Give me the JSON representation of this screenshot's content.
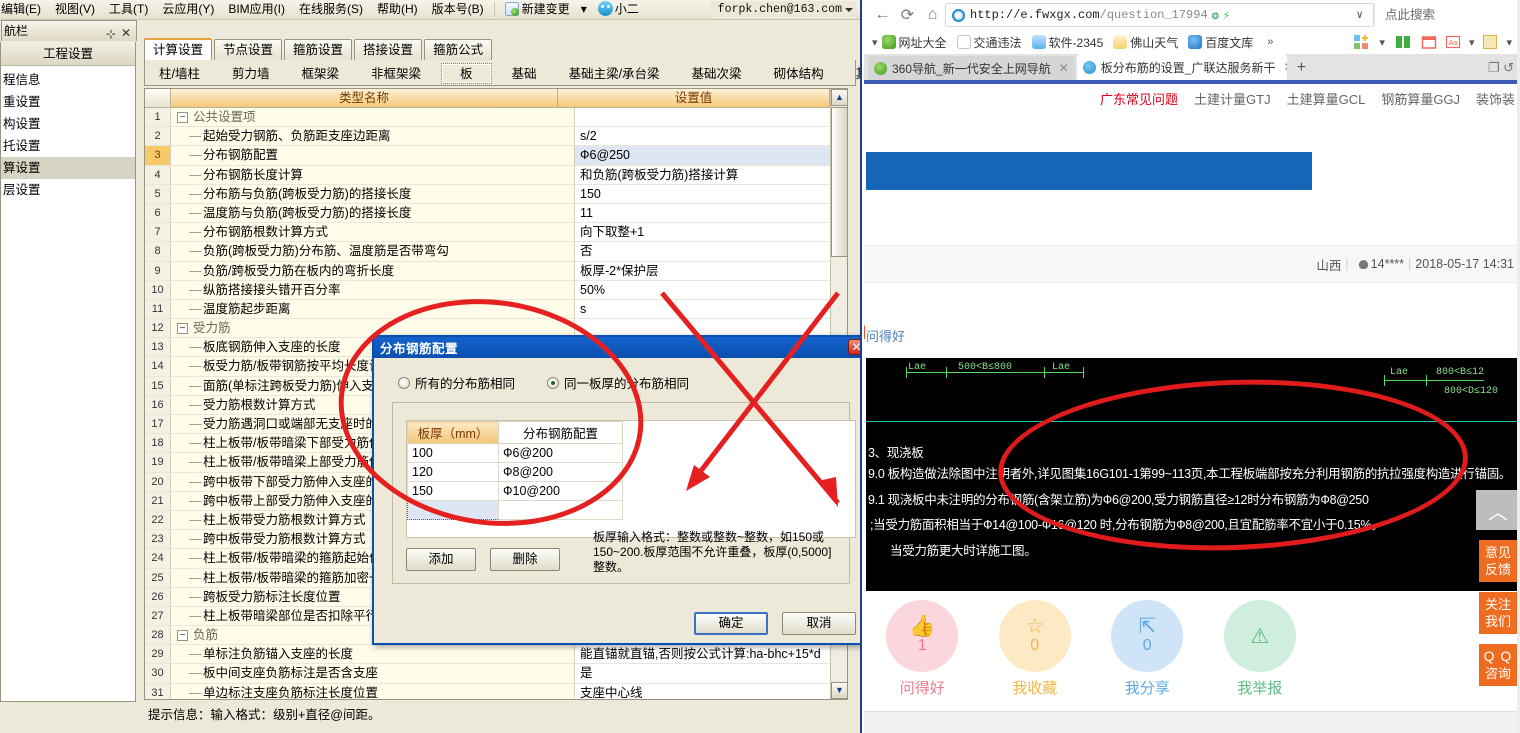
{
  "app": {
    "menubar": {
      "items": [
        "编辑(E)",
        "视图(V)",
        "工具(T)",
        "云应用(Y)",
        "BIM应用(I)",
        "在线服务(S)",
        "帮助(H)",
        "版本号(B)"
      ],
      "new_change_label": "新建变更",
      "qq_label": "小二",
      "account": "forpk.chen@163.com"
    },
    "dock": {
      "title": "航栏",
      "pin_icon": "pin-icon",
      "close_icon": "close-icon",
      "header": "工程设置",
      "items": [
        "程信息",
        "重设置",
        "构设置",
        "托设置",
        "算设置",
        "层设置"
      ],
      "selected_index": 4
    },
    "tabs_primary": [
      "计算设置",
      "节点设置",
      "箍筋设置",
      "搭接设置",
      "箍筋公式"
    ],
    "tabs_primary_active": 0,
    "tabs_secondary": [
      "柱/墙柱",
      "剪力墙",
      "框架梁",
      "非框架梁",
      "板",
      "基础",
      "基础主梁/承台梁",
      "基础次梁",
      "砌体结构",
      "其它"
    ],
    "tabs_secondary_active": 4,
    "grid": {
      "headers": {
        "num": "",
        "name": "类型名称",
        "value": "设置值"
      },
      "rows": [
        {
          "n": "1",
          "type": "group",
          "name": "公共设置项",
          "value": ""
        },
        {
          "n": "2",
          "type": "item",
          "name": "起始受力钢筋、负筋距支座边距离",
          "value": "s/2"
        },
        {
          "n": "3",
          "type": "item",
          "name": "分布钢筋配置",
          "value": "Ф6@250",
          "selected": true
        },
        {
          "n": "4",
          "type": "item",
          "name": "分布钢筋长度计算",
          "value": "和负筋(跨板受力筋)搭接计算"
        },
        {
          "n": "5",
          "type": "item",
          "name": "分布筋与负筋(跨板受力筋)的搭接长度",
          "value": "150"
        },
        {
          "n": "6",
          "type": "item",
          "name": "温度筋与负筋(跨板受力筋)的搭接长度",
          "value": "11"
        },
        {
          "n": "7",
          "type": "item",
          "name": "分布钢筋根数计算方式",
          "value": "向下取整+1"
        },
        {
          "n": "8",
          "type": "item",
          "name": "负筋(跨板受力筋)分布筋、温度筋是否带弯勾",
          "value": "否"
        },
        {
          "n": "9",
          "type": "item",
          "name": "负筋/跨板受力筋在板内的弯折长度",
          "value": "板厚-2*保护层"
        },
        {
          "n": "10",
          "type": "item",
          "name": "纵筋搭接接头错开百分率",
          "value": "50%"
        },
        {
          "n": "11",
          "type": "item",
          "name": "温度筋起步距离",
          "value": "s"
        },
        {
          "n": "12",
          "type": "group",
          "name": "受力筋",
          "value": ""
        },
        {
          "n": "13",
          "type": "item",
          "name": "板底钢筋伸入支座的长度",
          "value": ""
        },
        {
          "n": "14",
          "type": "item",
          "name": "板受力筋/板带钢筋按平均长度计算",
          "value": ""
        },
        {
          "n": "15",
          "type": "item",
          "name": "面筋(单标注跨板受力筋)伸入支座",
          "value": ""
        },
        {
          "n": "16",
          "type": "item",
          "name": "受力筋根数计算方式",
          "value": ""
        },
        {
          "n": "17",
          "type": "item",
          "name": "受力筋遇洞口或端部无支座时的",
          "value": ""
        },
        {
          "n": "18",
          "type": "item",
          "name": "柱上板带/板带暗梁下部受力筋伸",
          "value": ""
        },
        {
          "n": "19",
          "type": "item",
          "name": "柱上板带/板带暗梁上部受力筋伸",
          "value": ""
        },
        {
          "n": "20",
          "type": "item",
          "name": "跨中板带下部受力筋伸入支座的",
          "value": ""
        },
        {
          "n": "21",
          "type": "item",
          "name": "跨中板带上部受力筋伸入支座的",
          "value": ""
        },
        {
          "n": "22",
          "type": "item",
          "name": "柱上板带受力筋根数计算方式",
          "value": ""
        },
        {
          "n": "23",
          "type": "item",
          "name": "跨中板带受力筋根数计算方式",
          "value": ""
        },
        {
          "n": "24",
          "type": "item",
          "name": "柱上板带/板带暗梁的箍筋起始位",
          "value": ""
        },
        {
          "n": "25",
          "type": "item",
          "name": "柱上板带/板带暗梁的箍筋加密长",
          "value": ""
        },
        {
          "n": "26",
          "type": "item",
          "name": "跨板受力筋标注长度位置",
          "value": ""
        },
        {
          "n": "27",
          "type": "item",
          "name": "柱上板带暗梁部位是否扣除平行",
          "value": ""
        },
        {
          "n": "28",
          "type": "group",
          "name": "负筋",
          "value": ""
        },
        {
          "n": "29",
          "type": "item",
          "name": "单标注负筋锚入支座的长度",
          "value": "能直锚就直锚,否则按公式计算:ha-bhc+15*d"
        },
        {
          "n": "30",
          "type": "item",
          "name": "板中间支座负筋标注是否含支座",
          "value": "是"
        },
        {
          "n": "31",
          "type": "item",
          "name": "单边标注支座负筋标注长度位置",
          "value": "支座中心线"
        }
      ]
    },
    "statusbar": "提示信息：输入格式：级别+直径@间距。"
  },
  "dialog": {
    "title": "分布钢筋配置",
    "close_icon": "close-icon",
    "radio_all": "所有的分布筋相同",
    "radio_same_thickness": "同一板厚的分布筋相同",
    "radio_selected": "same_thickness",
    "table": {
      "headers": [
        "板厚（mm）",
        "分布钢筋配置"
      ],
      "rows": [
        {
          "thickness": "100",
          "rebar": "Ф6@200"
        },
        {
          "thickness": "120",
          "rebar": "Ф8@200"
        },
        {
          "thickness": "150",
          "rebar": "Ф10@200"
        },
        {
          "thickness": "",
          "rebar": ""
        }
      ]
    },
    "add_label": "添加",
    "delete_label": "删除",
    "hint": "板厚输入格式：整数或整数~整数，如150或150~200.板厚范围不允许重叠，板厚(0,5000]整数。",
    "ok_label": "确定",
    "cancel_label": "取消"
  },
  "browser": {
    "nav": {
      "back_icon": "back-arrow-icon",
      "reload_icon": "reload-icon",
      "home_icon": "home-icon",
      "url_domain": "http://e.fwxgx.com",
      "url_path": "/question_17994",
      "shield_icon": "shield-icon",
      "lightning_icon": "lightning-icon",
      "dropdown_icon": "chevron-down-icon",
      "search_placeholder": "点此搜索"
    },
    "bookmarks": [
      "网址大全",
      "交通违法",
      "软件-2345",
      "佛山天气",
      "百度文库"
    ],
    "bookmarks_more_icon": "chevron-double-right-icon",
    "toolbar_icons": [
      "apps-icon",
      "book-icon",
      "calendar-icon",
      "translate-icon",
      "notes-icon"
    ],
    "tabs": [
      {
        "title": "360导航_新一代安全上网导航",
        "active": false,
        "favicon": "360-icon"
      },
      {
        "title": "板分布筋的设置_广联达服务新干",
        "active": true,
        "favicon": "glodon-icon"
      }
    ],
    "new_tab_icon": "plus-icon",
    "tab_tools": [
      "restore-icon",
      "undo-icon"
    ],
    "site_nav": {
      "active": "广东常见问题",
      "items": [
        "土建计量GTJ",
        "土建算量GCL",
        "钢筋算量GGJ",
        "装饰装"
      ]
    },
    "meta": {
      "region": "山西",
      "user_icon": "user-icon",
      "user": "14****",
      "datetime": "2018-05-17 14:31"
    },
    "ask_good_label": "问得好",
    "cad": {
      "dims": [
        "Lae",
        "500<B≤800",
        "Lae",
        "Lae",
        "800<B≤12",
        "800<D≤120"
      ],
      "lines": [
        "3、现浇板",
        "9.0  板构造做法除图中注明者外,详见图集16G101-1第99~113页,本工程板端部按充分利用钢筋的抗拉强度构造进行锚固。",
        "9.1  现浇板中未注明的分布钢筋(含架立筋)为Ф6@200,受力钢筋直径≥12时分布钢筋为Ф8@250",
        ";当受力筋面积相当于Ф14@100-Ф16@120 时,分布钢筋为Ф8@200,且宜配筋率不宜小于0.15%。",
        "当受力筋更大时详施工图。"
      ]
    },
    "actions": [
      {
        "icon": "thumbs-up-icon",
        "count": "1",
        "label": "问得好",
        "glyph": "ὄD"
      },
      {
        "icon": "star-icon",
        "count": "0",
        "label": "我收藏",
        "glyph": "☆"
      },
      {
        "icon": "share-icon",
        "count": "0",
        "label": "我分享",
        "glyph": "⇗"
      },
      {
        "icon": "warning-icon",
        "count": "",
        "label": "我举报",
        "glyph": "⚠"
      }
    ],
    "rail": {
      "top_icon": "chevron-up-icon",
      "buttons": [
        {
          "line1": "意见",
          "line2": "反馈"
        },
        {
          "line1": "关注",
          "line2": "我们"
        },
        {
          "line1": "Q Q",
          "line2": "咨询"
        }
      ]
    }
  },
  "annotations": {
    "circle": "red-ellipse-annotation",
    "cross": "red-cross-annotation",
    "cad_circle": "red-ellipse-annotation"
  }
}
